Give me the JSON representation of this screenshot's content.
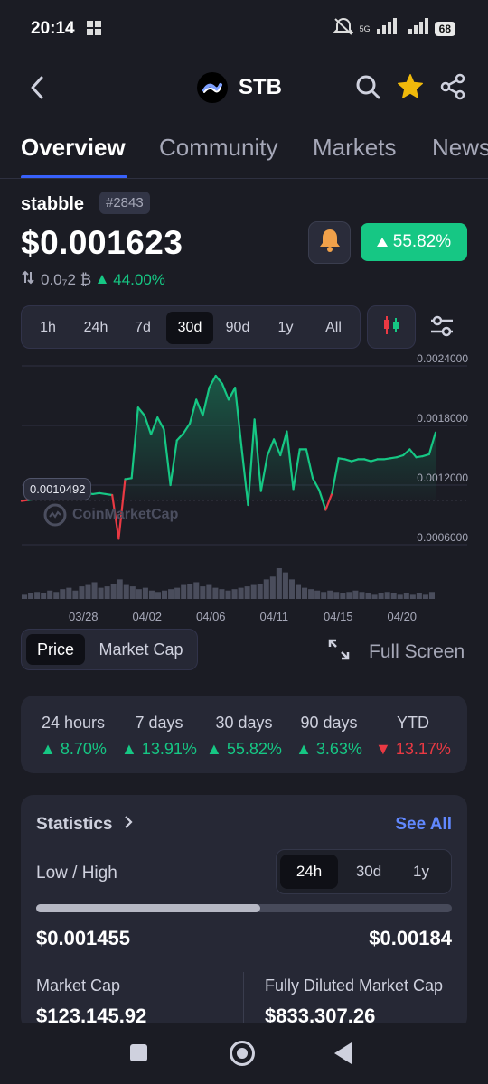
{
  "status_bar": {
    "time": "20:14",
    "battery": "68",
    "network": "5G"
  },
  "header": {
    "symbol": "STB",
    "back_icon": "chevron-left-icon",
    "icons": [
      "search-icon",
      "star-icon",
      "share-icon"
    ],
    "watchlisted": true
  },
  "tabs": [
    {
      "label": "Overview",
      "active": true
    },
    {
      "label": "Community",
      "active": false
    },
    {
      "label": "Markets",
      "active": false
    },
    {
      "label": "News",
      "active": false
    }
  ],
  "coin": {
    "name": "stabble",
    "rank": "#2843",
    "price": "$0.001623",
    "btc_price": "0.0₇2 ₿",
    "btc_change": "44.00%",
    "change_30d": "55.82%"
  },
  "range_options": [
    {
      "label": "1h",
      "active": false
    },
    {
      "label": "24h",
      "active": false
    },
    {
      "label": "7d",
      "active": false
    },
    {
      "label": "30d",
      "active": true
    },
    {
      "label": "90d",
      "active": false
    },
    {
      "label": "1y",
      "active": false
    },
    {
      "label": "All",
      "active": false
    }
  ],
  "chart_data": {
    "type": "area",
    "baseline": 0.0010492,
    "baseline_label": "0.0010492",
    "watermark": "CoinMarketCap",
    "yticks": [
      "0.0024000",
      "0.0018000",
      "0.0012000",
      "0.0006000"
    ],
    "ylim": [
      0.0006,
      0.0024
    ],
    "xticks": [
      "03/28",
      "04/02",
      "04/06",
      "04/11",
      "04/15",
      "04/20"
    ],
    "series": [
      {
        "values": [
          0.00104,
          0.00105,
          0.00106,
          0.00106,
          0.00107,
          0.00108,
          0.0011,
          0.00112,
          0.0011,
          0.00112,
          0.00112,
          0.00111,
          0.00112,
          0.00111,
          0.0011,
          0.00066,
          0.00126,
          0.00127,
          0.00198,
          0.0019,
          0.00171,
          0.00188,
          0.00176,
          0.0012,
          0.00165,
          0.00172,
          0.00182,
          0.00206,
          0.0019,
          0.00218,
          0.0023,
          0.00222,
          0.00206,
          0.00218,
          0.00158,
          0.001,
          0.00186,
          0.00114,
          0.0015,
          0.00166,
          0.0015,
          0.00174,
          0.00116,
          0.00156,
          0.00156,
          0.00127,
          0.00115,
          0.00095,
          0.00112,
          0.00147,
          0.00146,
          0.00144,
          0.00146,
          0.00146,
          0.00144,
          0.00146,
          0.00146,
          0.00147,
          0.00148,
          0.0015,
          0.00156,
          0.00148,
          0.00149,
          0.00151,
          0.00173
        ]
      }
    ],
    "volume": [
      3,
      4,
      5,
      4,
      6,
      5,
      7,
      8,
      6,
      9,
      10,
      12,
      8,
      9,
      11,
      14,
      10,
      9,
      7,
      8,
      6,
      5,
      6,
      7,
      8,
      10,
      11,
      12,
      9,
      10,
      8,
      7,
      6,
      7,
      8,
      9,
      10,
      11,
      14,
      16,
      22,
      19,
      14,
      10,
      8,
      7,
      6,
      5,
      6,
      5,
      4,
      5,
      6,
      5,
      4,
      3,
      4,
      5,
      4,
      3,
      4,
      3,
      4,
      3,
      5
    ]
  },
  "chart_toggle": {
    "price": "Price",
    "market_cap": "Market Cap",
    "fullscreen": "Full Screen"
  },
  "performance": [
    {
      "label": "24 hours",
      "value": "8.70%",
      "direction": "up"
    },
    {
      "label": "7 days",
      "value": "13.91%",
      "direction": "up"
    },
    {
      "label": "30 days",
      "value": "55.82%",
      "direction": "up"
    },
    {
      "label": "90 days",
      "value": "3.63%",
      "direction": "up"
    },
    {
      "label": "YTD",
      "value": "13.17%",
      "direction": "down"
    }
  ],
  "statistics": {
    "title": "Statistics",
    "see_all": "See All",
    "low_high_label": "Low / High",
    "periods": [
      {
        "label": "24h",
        "active": true
      },
      {
        "label": "30d",
        "active": false
      },
      {
        "label": "1y",
        "active": false
      }
    ],
    "low": "$0.001455",
    "high": "$0.00184",
    "range_position": 0.54,
    "market_cap_label": "Market Cap",
    "market_cap": "$123,145.92",
    "fdv_label": "Fully Diluted Market Cap",
    "fdv": "$833,307.26"
  },
  "colors": {
    "up": "#16c784",
    "down": "#ea3943",
    "accent": "#3861fb",
    "link": "#6188ff",
    "star": "#f0b90b"
  }
}
